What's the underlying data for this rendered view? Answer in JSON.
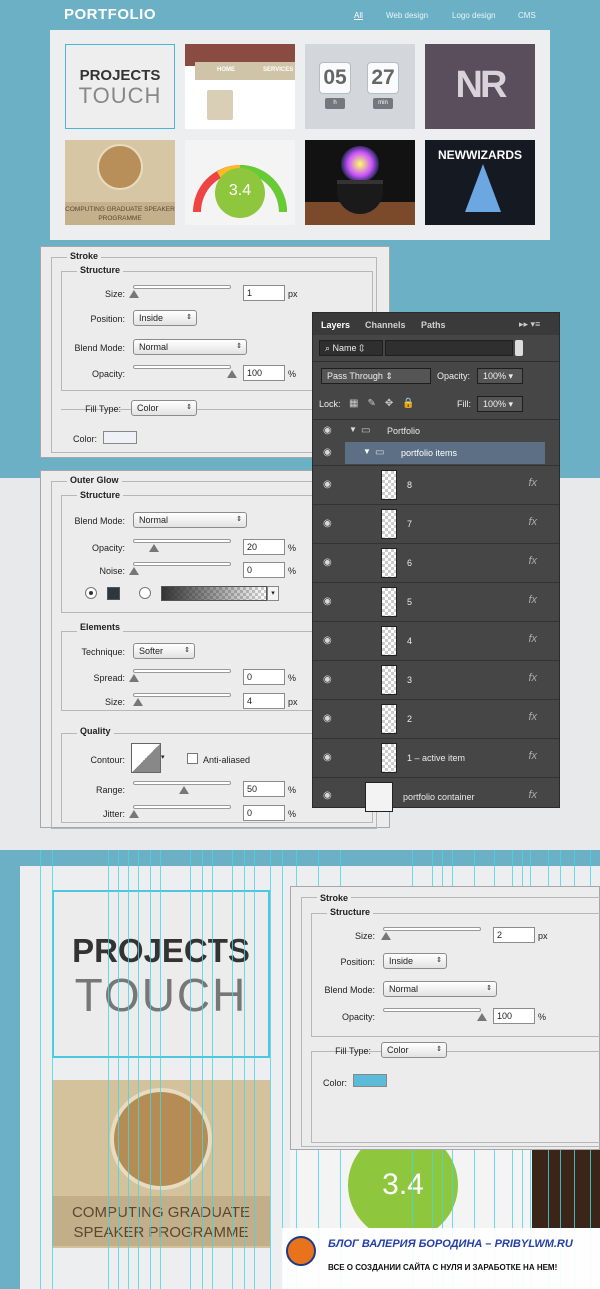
{
  "header": {
    "brand": "PORTFOLIO",
    "nav": [
      "All",
      "Web design",
      "Logo design",
      "CMS"
    ],
    "active_nav": "All"
  },
  "tiles": {
    "projects_line1": "PROJECTS",
    "projects_line2": "TOUCH",
    "web_home": "HOME",
    "web_services": "SERVICES",
    "clock_hours": "05",
    "clock_minutes": "27",
    "clock_hours_unit": "h",
    "clock_minutes_unit": "min",
    "nr_logo": "NR",
    "mic_label": "COMPUTING GRADUATE SPEAKER PROGRAMME",
    "gauge_value": "3.4",
    "wizards_title": "NEWWIZARDS"
  },
  "stroke1": {
    "title": "Stroke",
    "structure": "Structure",
    "size_label": "Size:",
    "size_value": "1",
    "size_unit": "px",
    "position_label": "Position:",
    "position_value": "Inside",
    "blend_label": "Blend Mode:",
    "blend_value": "Normal",
    "opacity_label": "Opacity:",
    "opacity_value": "100",
    "opacity_unit": "%",
    "filltype_label": "Fill Type:",
    "filltype_value": "Color",
    "color_label": "Color:",
    "color_hex": "#eef1f6"
  },
  "glow": {
    "title": "Outer Glow",
    "structure": "Structure",
    "blend_label": "Blend Mode:",
    "blend_value": "Normal",
    "opacity_label": "Opacity:",
    "opacity_value": "20",
    "opacity_unit": "%",
    "noise_label": "Noise:",
    "noise_value": "0",
    "noise_unit": "%",
    "elements": "Elements",
    "technique_label": "Technique:",
    "technique_value": "Softer",
    "spread_label": "Spread:",
    "spread_value": "0",
    "spread_unit": "%",
    "size_label": "Size:",
    "size_value": "4",
    "size_unit": "px",
    "quality": "Quality",
    "contour_label": "Contour:",
    "antialiased_label": "Anti-aliased",
    "range_label": "Range:",
    "range_value": "50",
    "range_unit": "%",
    "jitter_label": "Jitter:",
    "jitter_value": "0",
    "jitter_unit": "%",
    "glow_color": "#2d3740"
  },
  "layers": {
    "tabs": [
      "Layers",
      "Channels",
      "Paths"
    ],
    "filter_label": "Name",
    "blend_value": "Pass Through",
    "opacity_label": "Opacity:",
    "opacity_value": "100%",
    "lock_label": "Lock:",
    "fill_label": "Fill:",
    "fill_value": "100%",
    "group": "Portfolio",
    "subgroup": "portfolio items",
    "items": [
      "8",
      "7",
      "6",
      "5",
      "4",
      "3",
      "2",
      "1 – active item"
    ],
    "container": "portfolio container",
    "fx": "fx"
  },
  "stroke2": {
    "title": "Stroke",
    "structure": "Structure",
    "size_label": "Size:",
    "size_value": "2",
    "size_unit": "px",
    "position_label": "Position:",
    "position_value": "Inside",
    "blend_label": "Blend Mode:",
    "blend_value": "Normal",
    "opacity_label": "Opacity:",
    "opacity_value": "100",
    "opacity_unit": "%",
    "filltype_label": "Fill Type:",
    "filltype_value": "Color",
    "color_label": "Color:",
    "color_hex": "#5bbbd8"
  },
  "zoom": {
    "projects_line1": "PROJECTS",
    "projects_line2": "TOUCH",
    "mic_label_line1": "COMPUTING GRADUATE",
    "mic_label_line2": "SPEAKER PROGRAMME",
    "gauge_value": "3.4"
  },
  "watermark": {
    "line1": "БЛОГ ВАЛЕРИЯ БОРОДИНА – PRIBYLWM.RU",
    "line2": "ВСЕ О СОЗДАНИИ САЙТА С НУЛЯ И ЗАРАБОТКЕ НА НЕМ!"
  }
}
